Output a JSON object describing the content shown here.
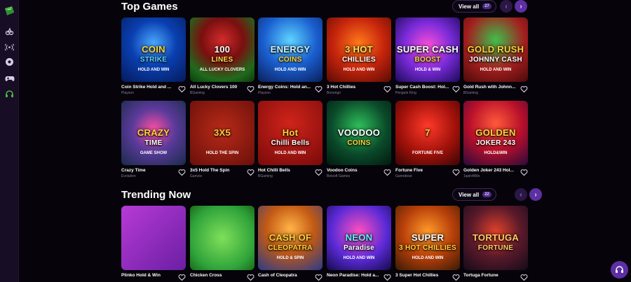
{
  "sidebar": {
    "items": [
      {
        "icon": "sports-ball-icon"
      },
      {
        "icon": "live-broadcast-icon"
      },
      {
        "icon": "soccer-icon"
      },
      {
        "icon": "gamepad-icon"
      },
      {
        "icon": "headset-icon"
      }
    ]
  },
  "sections": [
    {
      "title": "Top Games",
      "view_all": "View all",
      "count": "27",
      "games": [
        {
          "name": "Coin Strike Hold and ...",
          "provider": "Playson",
          "art": [
            "COIN",
            "STRIKE",
            "HOLD AND WIN"
          ]
        },
        {
          "name": "All Lucky Clovers 100",
          "provider": "BGaming",
          "art": [
            "100",
            "LINES",
            "ALL LUCKY CLOVERS"
          ]
        },
        {
          "name": "Energy Coins: Hold an...",
          "provider": "Playson",
          "art": [
            "ENERGY",
            "COINS",
            "HOLD AND WIN"
          ]
        },
        {
          "name": "3 Hot Chillies",
          "provider": "Booongo",
          "art": [
            "3 HOT",
            "CHILLIES",
            "HOLD AND WIN"
          ]
        },
        {
          "name": "Super Cash Boost: Hol...",
          "provider": "Penguin King",
          "art": [
            "SUPER CASH",
            "BOOST",
            "HOLD & WIN"
          ]
        },
        {
          "name": "Gold Rush with Johnn...",
          "provider": "BGaming",
          "art": [
            "GOLD RUSH",
            "JOHNNY CASH",
            "HOLD AND WIN"
          ]
        },
        {
          "name": "Crazy Time",
          "provider": "Evolution",
          "art": [
            "CRAZY",
            "TIME",
            "GAME SHOW"
          ]
        },
        {
          "name": "3x5 Hold The Spin",
          "provider": "Gamzix",
          "art": [
            "3X5",
            "",
            "HOLD THE SPIN"
          ]
        },
        {
          "name": "Hot Chilli Bells",
          "provider": "BGaming",
          "art": [
            "Hot",
            "Chilli Bells",
            "HOLD AND WIN"
          ]
        },
        {
          "name": "Voodoo Coins",
          "provider": "Betsoft Games",
          "art": [
            "VOODOO",
            "COINS",
            ""
          ]
        },
        {
          "name": "Fortune Five",
          "provider": "Gamebeat",
          "art": [
            "7",
            "",
            "FORTUNE FIVE"
          ]
        },
        {
          "name": "Golden Joker 243 Hol...",
          "provider": "1spin4Win",
          "art": [
            "GOLDEN",
            "JOKER 243",
            "HOLD&WIN"
          ]
        }
      ]
    },
    {
      "title": "Trending Now",
      "view_all": "View all",
      "count": "22",
      "games": [
        {
          "name": "Plinko Hold & Win",
          "provider": "",
          "art": [
            "",
            "",
            ""
          ]
        },
        {
          "name": "Chicken Cross",
          "provider": "",
          "art": [
            "",
            "",
            ""
          ]
        },
        {
          "name": "Cash of Cleopatra",
          "provider": "",
          "art": [
            "CASH OF",
            "CLEOPATRA",
            "HOLD & SPIN"
          ]
        },
        {
          "name": "Neon Paradise: Hold a...",
          "provider": "",
          "art": [
            "NEON",
            "Paradise",
            "HOLD AND WIN"
          ]
        },
        {
          "name": "3 Super Hot Chillies",
          "provider": "",
          "art": [
            "SUPER",
            "3 HOT CHILLIES",
            "HOLD AND WIN"
          ]
        },
        {
          "name": "Tortuga Fortune",
          "provider": "",
          "art": [
            "TORTUGA",
            "FORTUNE",
            ""
          ]
        }
      ]
    }
  ],
  "colors": {
    "accent": "#5d2fa3",
    "background": "#06040a",
    "sidebar": "#170d24"
  }
}
